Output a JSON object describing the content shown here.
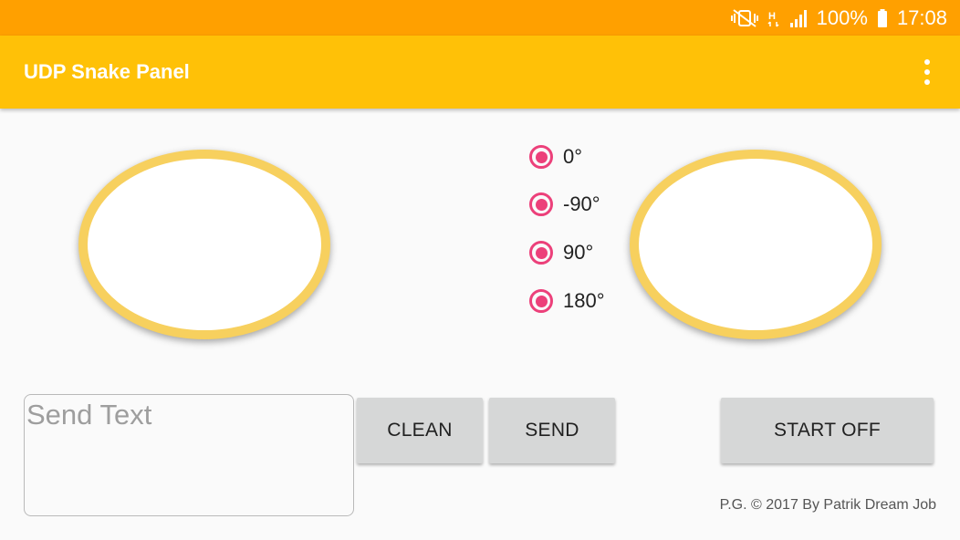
{
  "status_bar": {
    "battery_percent": "100%",
    "time": "17:08",
    "icons": [
      "mute-vibrate-icon",
      "hplus-data-icon",
      "signal-icon",
      "battery-icon"
    ],
    "network_label": "H"
  },
  "app_bar": {
    "title": "UDP Snake Panel",
    "menu_icon": "overflow-menu-icon"
  },
  "joysticks": {
    "left": {
      "name": "left-joystick"
    },
    "right": {
      "name": "right-joystick"
    }
  },
  "rotation_options": [
    {
      "label": "0°",
      "selected": true
    },
    {
      "label": "-90°",
      "selected": true
    },
    {
      "label": "90°",
      "selected": true
    },
    {
      "label": "180°",
      "selected": true
    }
  ],
  "send_field": {
    "placeholder": "Send Text",
    "value": ""
  },
  "buttons": {
    "clean": "CLEAN",
    "send": "SEND",
    "start": "START OFF"
  },
  "footer": "P.G. © 2017 By Patrik Dream Job",
  "colors": {
    "status_bar": "#ffa000",
    "app_bar": "#ffc107",
    "accent": "#ec407a",
    "joystick_ring": "#f7d05e"
  }
}
